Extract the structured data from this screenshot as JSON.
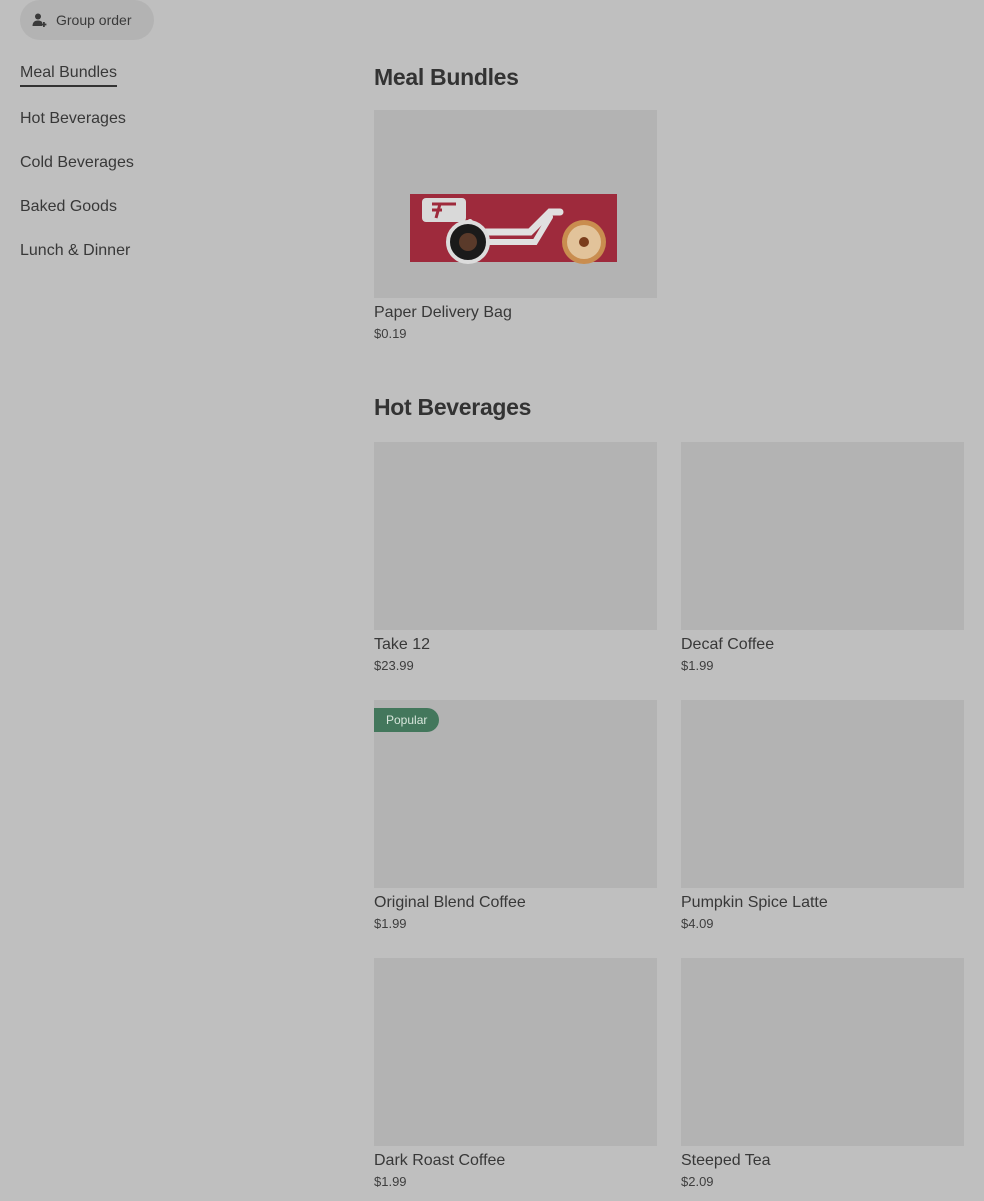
{
  "toolbar": {
    "group_order_label": "Group order",
    "group_order_icon": "add-person-icon"
  },
  "nav": {
    "items": [
      {
        "label": "Meal Bundles",
        "active": true
      },
      {
        "label": "Hot Beverages",
        "active": false
      },
      {
        "label": "Cold Beverages",
        "active": false
      },
      {
        "label": "Baked Goods",
        "active": false
      },
      {
        "label": "Lunch & Dinner",
        "active": false
      }
    ]
  },
  "sections": {
    "meal_bundles": {
      "title": "Meal Bundles",
      "items": [
        {
          "name": "Paper Delivery Bag",
          "price": "$0.19",
          "image": "delivery-bike-coffee-donut"
        }
      ]
    },
    "hot_beverages": {
      "title": "Hot Beverages",
      "items": [
        {
          "name": "Take 12",
          "price": "$23.99"
        },
        {
          "name": "Decaf Coffee",
          "price": "$1.99"
        },
        {
          "name": "Original Blend Coffee",
          "price": "$1.99",
          "badge": "Popular"
        },
        {
          "name": "Pumpkin Spice Latte",
          "price": "$4.09"
        },
        {
          "name": "Dark Roast Coffee",
          "price": "$1.99"
        },
        {
          "name": "Steeped Tea",
          "price": "$2.09"
        }
      ]
    }
  },
  "colors": {
    "overlay_bg": "#bfbfbf",
    "thumb_placeholder": "#b3b3b3",
    "badge_green": "#43775c",
    "brand_red": "#9e2a3c"
  }
}
